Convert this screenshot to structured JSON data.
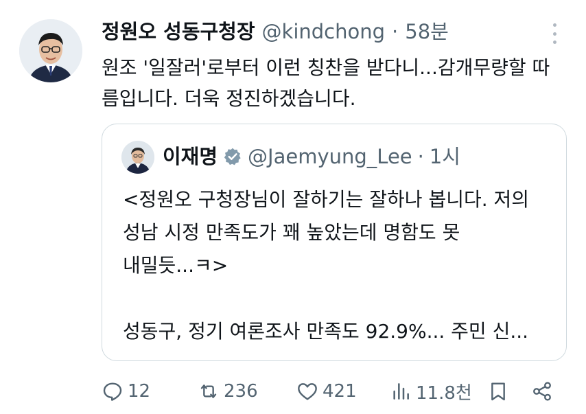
{
  "tweet": {
    "author_name": "정원오 성동구청장",
    "handle": "@kindchong",
    "separator": "·",
    "time": "58분",
    "text": "원조 '일잘러'로부터 이런 칭찬을 받다니...감개무량할 따름입니다. 더욱 정진하겠습니다."
  },
  "quote": {
    "author_name": "이재명",
    "handle": "@Jaemyung_Lee",
    "separator": "·",
    "time": "1시",
    "lines": [
      "<정원오 구청장님이 잘하기는 잘하나 봅니다. 저의",
      "성남 시정 만족도가 꽤 높았는데 명함도 못",
      "내밀듯...ㅋ>",
      "",
      "성동구, 정기 여론조사 만족도 92.9%... 주민 신..."
    ]
  },
  "actions": {
    "reply_count": "12",
    "retweet_count": "236",
    "like_count": "421",
    "views_count": "11.8천"
  },
  "colors": {
    "text": "#0f1419",
    "muted": "#536471",
    "border": "#cfd9de"
  }
}
